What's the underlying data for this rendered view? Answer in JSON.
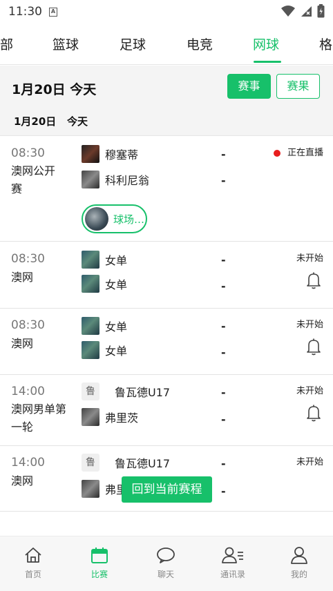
{
  "status_bar": {
    "time": "11:30"
  },
  "tabs": [
    {
      "label": "部"
    },
    {
      "label": "篮球"
    },
    {
      "label": "足球"
    },
    {
      "label": "电竞"
    },
    {
      "label": "网球"
    },
    {
      "label": "格"
    }
  ],
  "header": {
    "date_title": "1月20日 今天",
    "events_button": "赛事",
    "results_button": "赛果",
    "sub_date": "1月20日",
    "sub_today": "今天"
  },
  "matches": [
    {
      "time": "08:30",
      "competition": "澳网公开赛",
      "player1": "穆塞蒂",
      "player2": "科利尼翁",
      "score1": "-",
      "score2": "-",
      "status": "正在直播",
      "venue": "球场…"
    },
    {
      "time": "08:30",
      "competition": "澳网",
      "player1": "女单",
      "player2": "女单",
      "score1": "-",
      "score2": "-",
      "status": "未开始"
    },
    {
      "time": "08:30",
      "competition": "澳网",
      "player1": "女单",
      "player2": "女单",
      "score1": "-",
      "score2": "-",
      "status": "未开始"
    },
    {
      "time": "14:00",
      "competition": "澳网男单第一轮",
      "player1_badge": "鲁",
      "player1": "鲁瓦德U17",
      "player2": "弗里茨",
      "score1": "-",
      "score2": "-",
      "status": "未开始"
    },
    {
      "time": "14:00",
      "competition": "澳网",
      "player1_badge": "鲁",
      "player1": "鲁瓦德U17",
      "player2": "弗里",
      "score1": "-",
      "score2": "-",
      "status": "未开始"
    }
  ],
  "float_button": "回到当前赛程",
  "bottom_nav": [
    {
      "label": "首页"
    },
    {
      "label": "比赛"
    },
    {
      "label": "聊天"
    },
    {
      "label": "通讯录"
    },
    {
      "label": "我的"
    }
  ],
  "colors": {
    "accent": "#17c06a",
    "live": "#e81d1d"
  }
}
